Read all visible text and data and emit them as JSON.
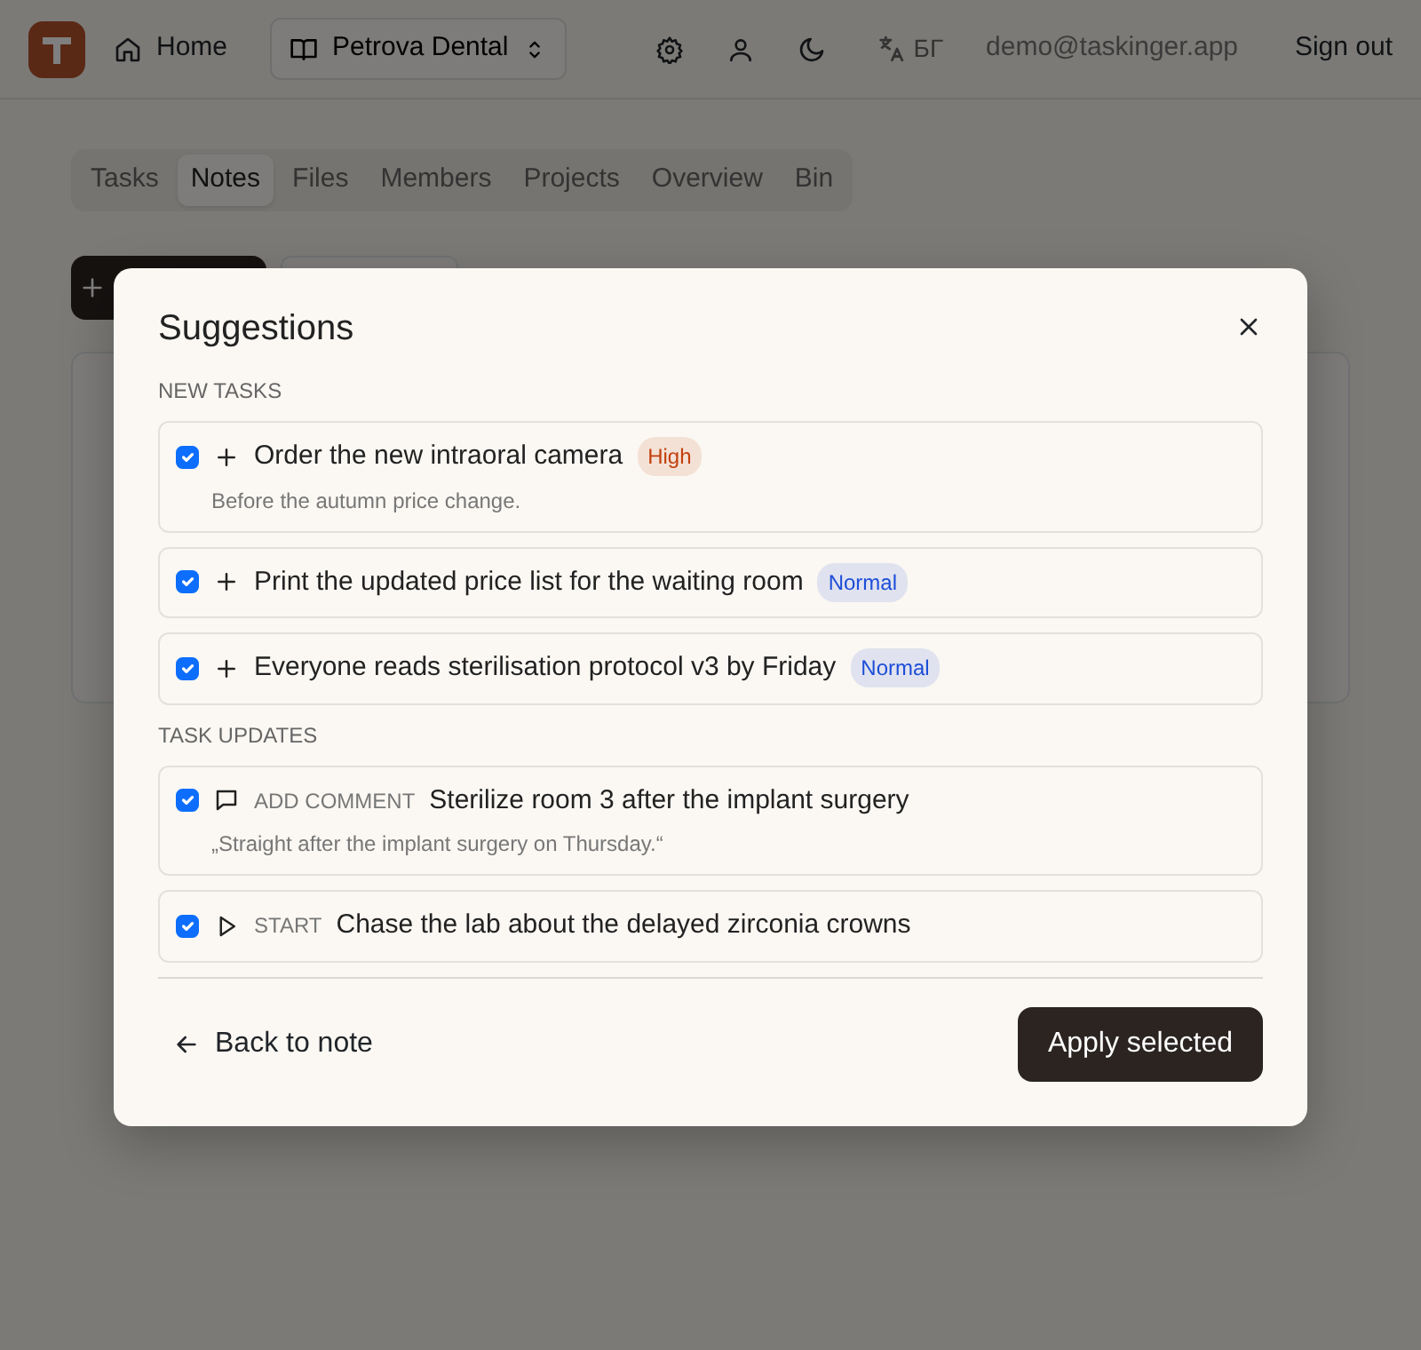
{
  "navbar": {
    "home": "Home",
    "workspace": "Petrova Dental",
    "language": "БГ",
    "email": "demo@taskinger.app",
    "sign_out": "Sign out"
  },
  "tabs": [
    {
      "label": "Tasks",
      "selected": false
    },
    {
      "label": "Notes",
      "selected": true
    },
    {
      "label": "Files",
      "selected": false
    },
    {
      "label": "Members",
      "selected": false
    },
    {
      "label": "Projects",
      "selected": false
    },
    {
      "label": "Overview",
      "selected": false
    },
    {
      "label": "Bin",
      "selected": false
    }
  ],
  "modal": {
    "title": "Suggestions",
    "sections": [
      {
        "heading": "NEW TASKS",
        "items": [
          {
            "kind": "new",
            "checked": true,
            "title": "Order the new intraoral camera",
            "priority": {
              "label": "High",
              "color": "#c2410c"
            },
            "note": "Before the autumn price change."
          },
          {
            "kind": "new",
            "checked": true,
            "title": "Print the updated price list for the waiting room",
            "priority": {
              "label": "Normal",
              "color": "#1d4ed8"
            }
          },
          {
            "kind": "new",
            "checked": true,
            "title": "Everyone reads sterilisation protocol v3 by Friday",
            "priority": {
              "label": "Normal",
              "color": "#1d4ed8"
            }
          }
        ]
      },
      {
        "heading": "TASK UPDATES",
        "items": [
          {
            "kind": "comment",
            "checked": true,
            "action": "ADD COMMENT",
            "title": "Sterilize room 3 after the implant surgery",
            "note": "„Straight after the implant surgery on Thursday.“"
          },
          {
            "kind": "start",
            "checked": true,
            "action": "START",
            "title": "Chase the lab about the delayed zirconia crowns"
          }
        ]
      }
    ],
    "back": "Back to note",
    "apply": "Apply selected"
  }
}
